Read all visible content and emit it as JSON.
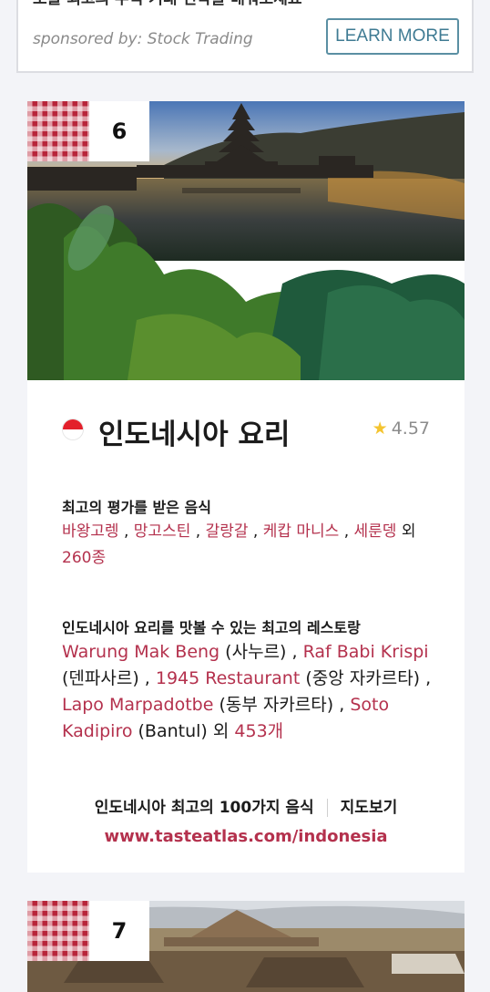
{
  "ad": {
    "headline": "오늘 최고의 주식 거래 전략을 배워보세요",
    "sponsor": "sponsored by: Stock Trading",
    "button": "LEARN MORE"
  },
  "cards": [
    {
      "rank": "6",
      "image": "bali-temple-lake-photo",
      "flag": "indonesia-flag-icon",
      "title": "인도네시아 요리",
      "rating": "4.57",
      "dishes_heading": "최고의 평가를 받은 음식",
      "dishes": [
        "바왕고렝",
        "망고스틴",
        "갈랑갈",
        "케캅 마니스",
        "세룬뎅"
      ],
      "dishes_more_prefix": "외",
      "dishes_more": "260종",
      "restaurants_heading": "인도네시아 요리를 맛볼 수 있는 최고의 레스토랑",
      "restaurants": [
        {
          "name": "Warung Mak Beng",
          "location": "(사누르)"
        },
        {
          "name": "Raf Babi Krispi",
          "location": "(덴파사르)"
        },
        {
          "name": "1945 Restaurant",
          "location": "(중앙 자카르타)"
        },
        {
          "name": "Lapo Marpadotbe",
          "location": "(동부 자카르타)"
        },
        {
          "name": "Soto Kadipiro",
          "location": "(Bantul)"
        }
      ],
      "restaurants_more_prefix": "외",
      "restaurants_more": "453개",
      "top100_link": "인도네시아 최고의 100가지 음식",
      "map_link": "지도보기",
      "url": "www.tasteatlas.com/indonesia"
    },
    {
      "rank": "7",
      "image": "teotihuacan-pyramid-photo"
    }
  ],
  "colors": {
    "accent": "#b4314d",
    "background": "#f3f4f8",
    "checker": "#b8253a",
    "star": "#f4c430"
  }
}
